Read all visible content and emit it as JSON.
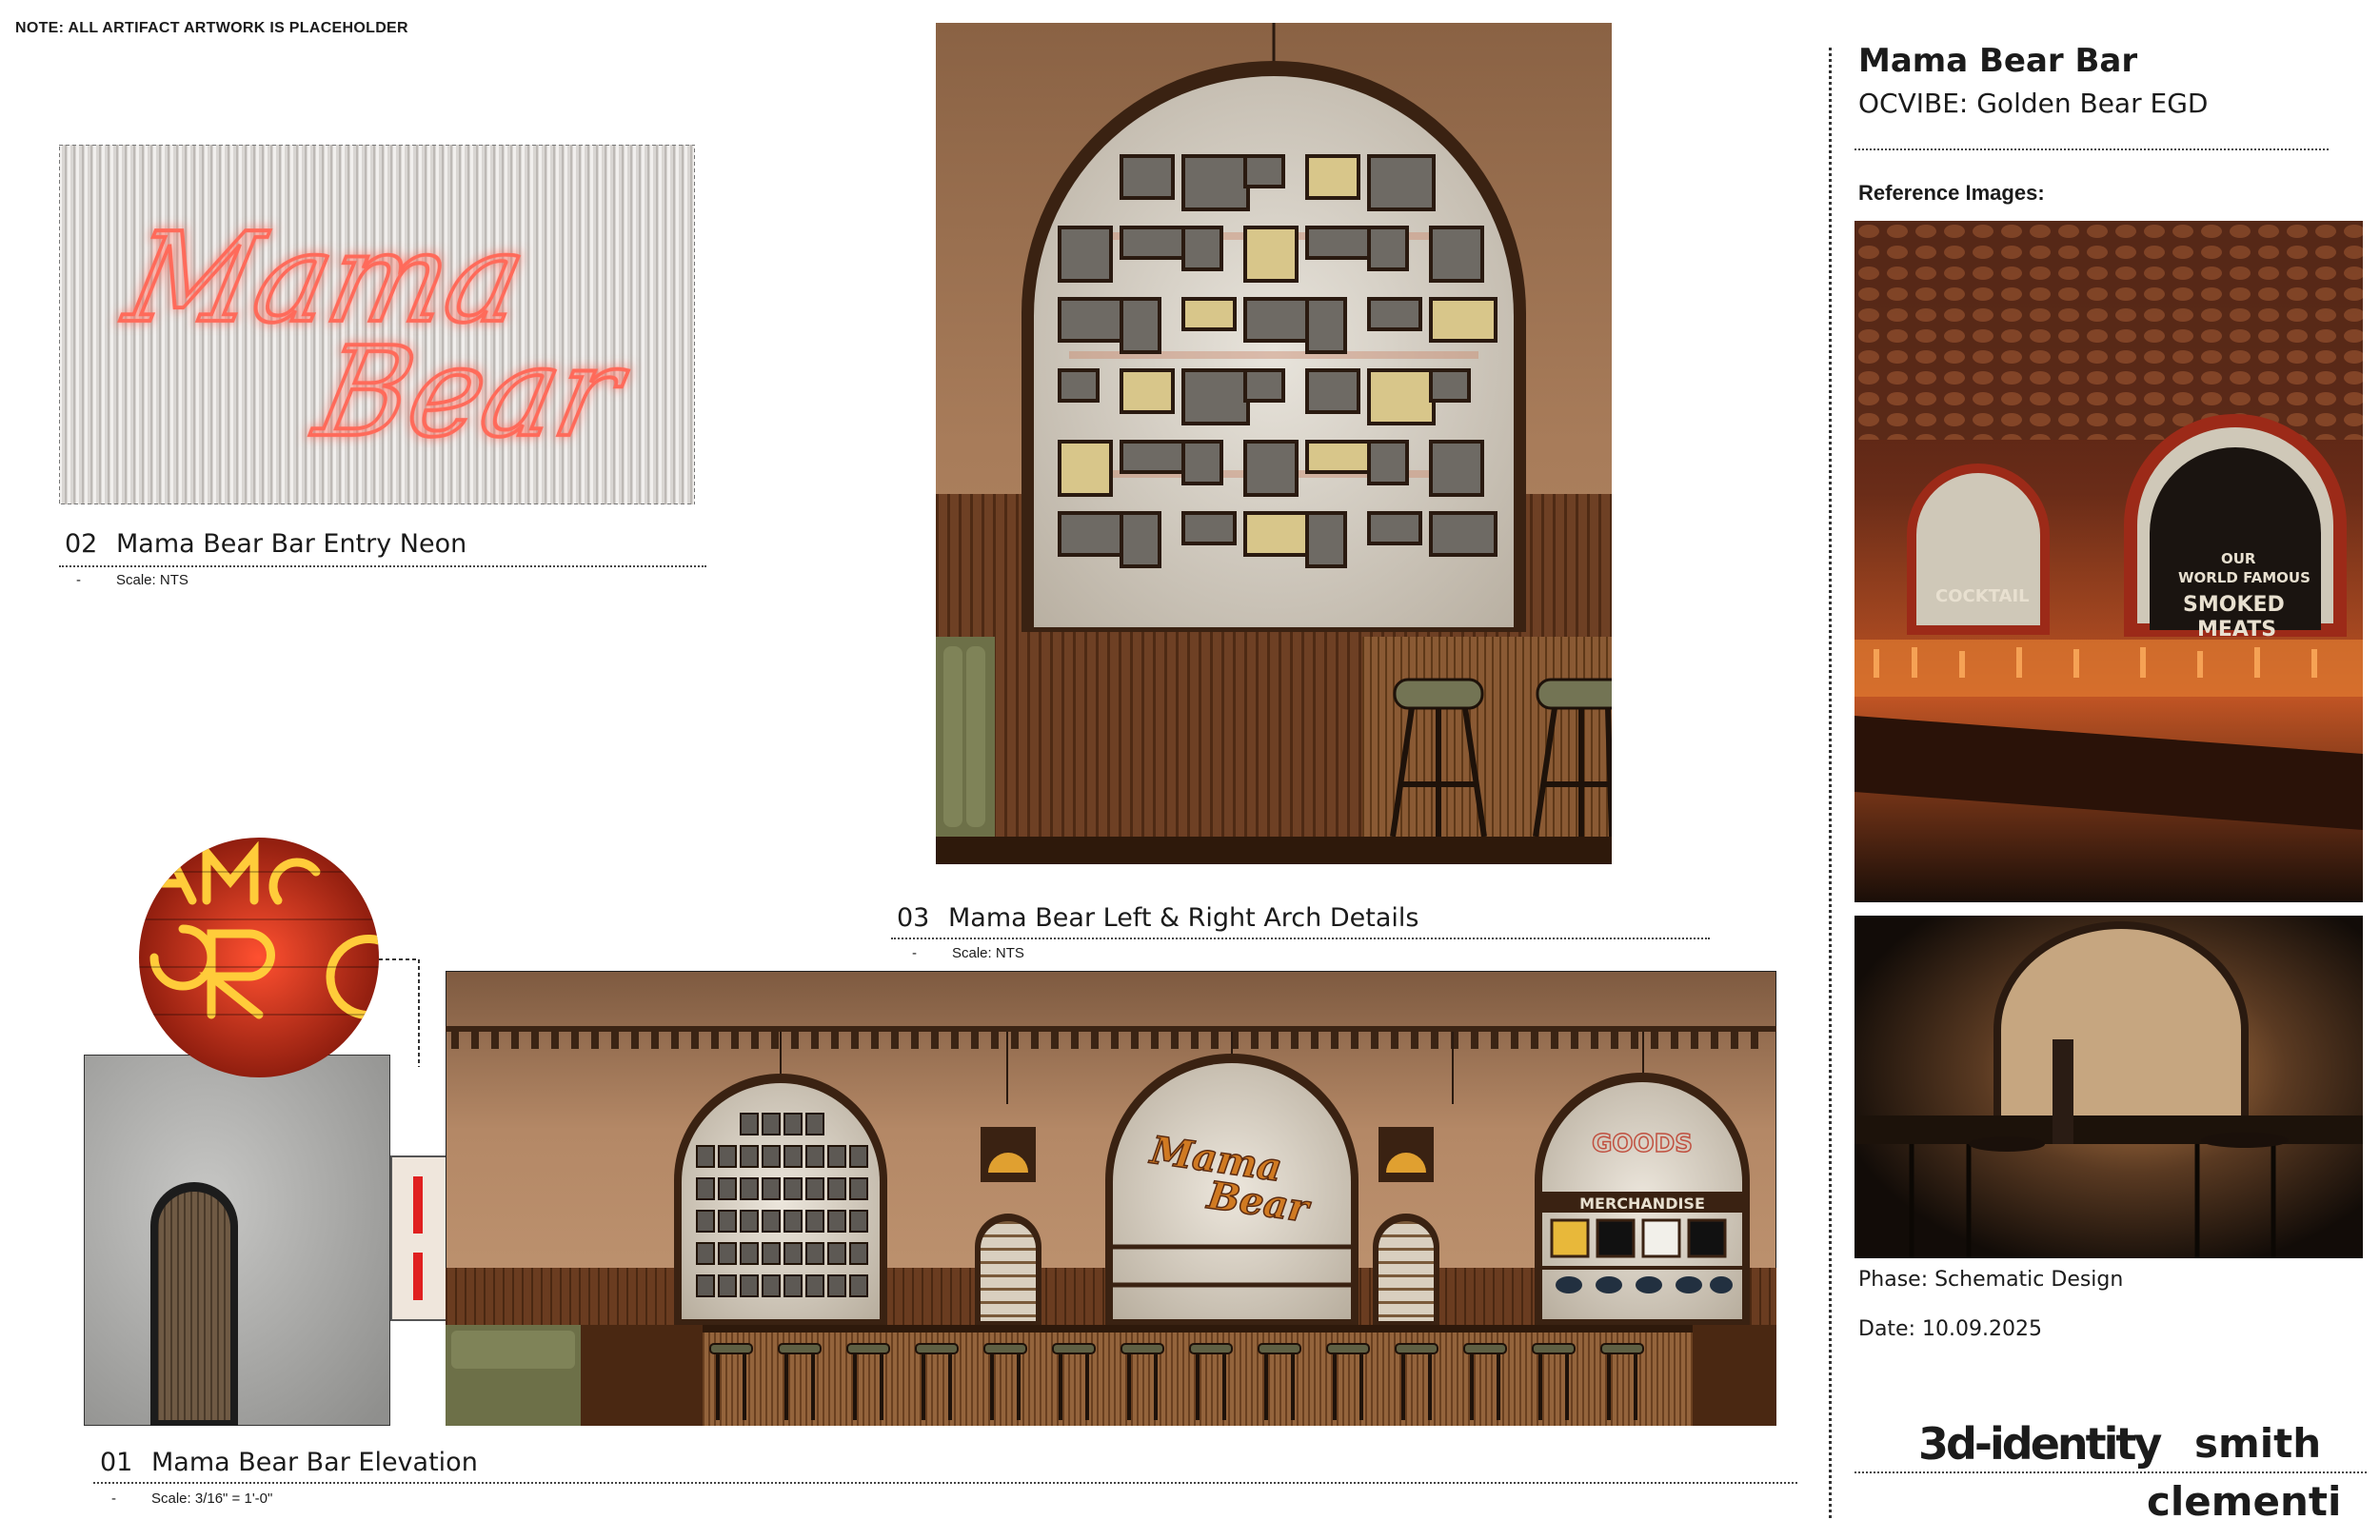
{
  "note": "NOTE: ALL ARTIFACT ARTWORK IS PLACEHOLDER",
  "header": {
    "title": "Mama Bear Bar",
    "subtitle": "OCVIBE: Golden Bear EGD"
  },
  "reference_label": "Reference Images:",
  "reference_photo_1": {
    "signage": [
      "COCKTAIL",
      "OUR",
      "WORLD FAMOUS",
      "SMOKED",
      "MEATS"
    ]
  },
  "panels": {
    "neon": {
      "number": "02",
      "title": "Mama Bear Bar Entry Neon",
      "dash": "-",
      "scale": "Scale: NTS",
      "neon_line1": "Mama",
      "neon_line2": "Bear"
    },
    "arch": {
      "number": "03",
      "title": "Mama Bear Left & Right Arch Details",
      "dash": "-",
      "scale": "Scale: NTS"
    },
    "elevation": {
      "number": "01",
      "title": "Mama Bear Bar Elevation",
      "dash": "-",
      "scale": "Scale: 3/16\" = 1'-0\"",
      "center_sign_line1": "Mama",
      "center_sign_line2": "Bear",
      "right_sign_line1": "GOODS",
      "right_sign_line2": "MERCHANDISE"
    }
  },
  "phase": "Phase: Schematic Design",
  "date": "Date: 10.09.2025",
  "logos": {
    "left": "3d-identity",
    "right_line1": "smith",
    "right_line2": "clementi"
  },
  "colors": {
    "neon": "#ff5a4a",
    "wall": "#a87a5a",
    "wood": "#6b3f22",
    "bar_front": "#4a2812"
  }
}
